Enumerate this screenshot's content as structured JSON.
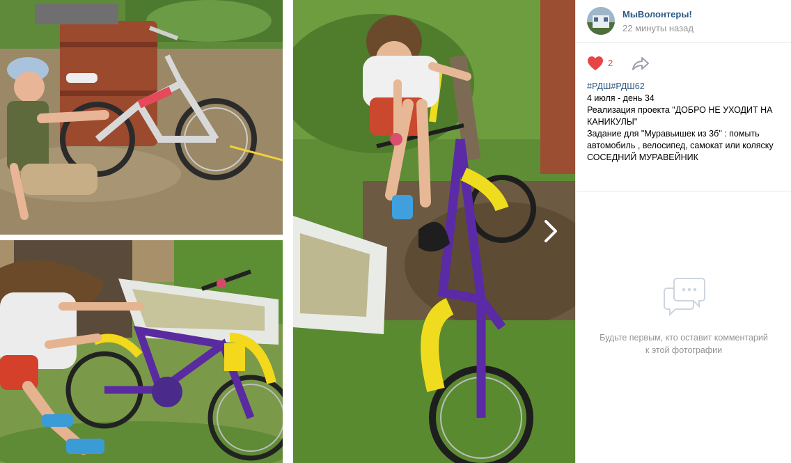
{
  "viewer": {
    "photos": [
      {
        "name": "photo-boy-bicycle"
      },
      {
        "name": "photo-girl-bicycle-bathtub"
      },
      {
        "name": "photo-girl-purple-bicycle"
      }
    ],
    "next_icon": "chevron-right-icon"
  },
  "post": {
    "author": "МыВолонтеры!",
    "time": "22 минуты назад",
    "likes": "2",
    "like_icon": "heart-icon",
    "share_icon": "share-arrow-icon",
    "hashtags": "#РДШ#РДШ62",
    "lines": [
      "4 июля - день 34",
      "Реализация проекта \"ДОБРО НЕ УХОДИТ НА КАНИКУЛЫ\"",
      "Задание для \"Муравьишек из 3б\" : помыть автомобиль , велосипед, самокат или коляску",
      "СОСЕДНИЙ МУРАВЕЙНИК"
    ]
  },
  "comments": {
    "icon": "comment-bubble-icon",
    "empty_text": "Будьте первым, кто оставит комментарий к этой фотографии"
  },
  "colors": {
    "link": "#2a5885",
    "like": "#e64646",
    "muted": "#939393",
    "divider": "#e7e8ec"
  }
}
